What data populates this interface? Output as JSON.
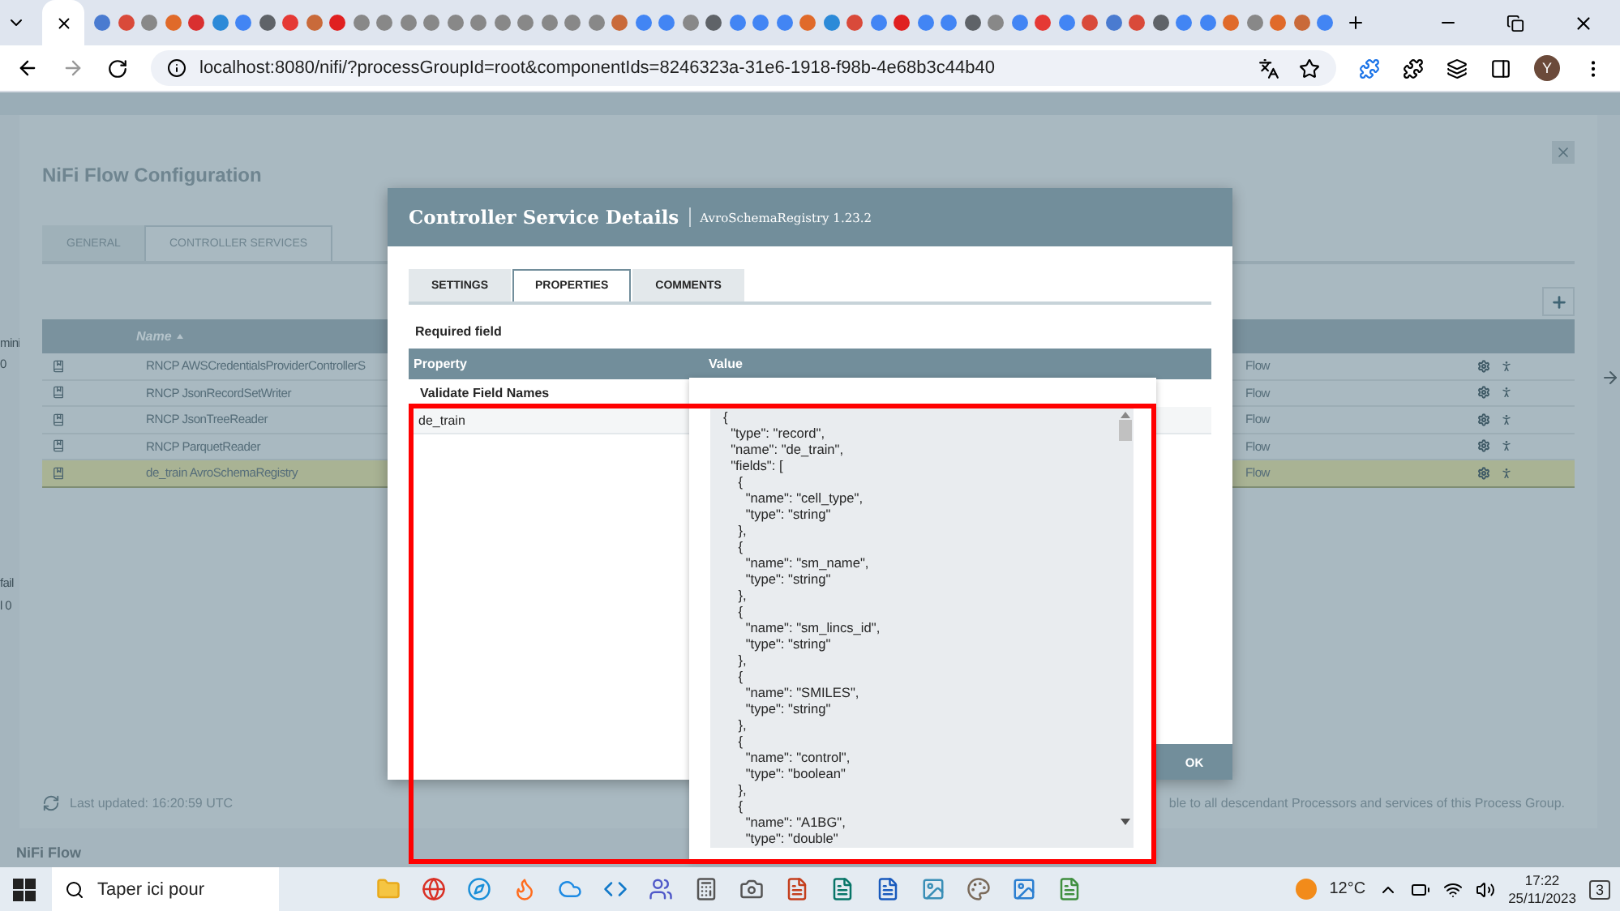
{
  "browser": {
    "url": "localhost:8080/nifi/?processGroupId=root&componentIds=8246323a-31e6-1918-f98b-4e68b3c44b40",
    "profile_initial": "Y"
  },
  "canvas": {
    "left_labels": [
      "mini",
      "0",
      "fail",
      "l 0"
    ],
    "breadcrumb": "NiFi Flow"
  },
  "flow_configuration": {
    "title": "NiFi Flow Configuration",
    "tabs": [
      {
        "label": "GENERAL",
        "selected": false
      },
      {
        "label": "CONTROLLER SERVICES",
        "selected": true
      }
    ],
    "name_column": {
      "label": "Name",
      "sorted": true
    },
    "services": [
      {
        "name": "RNCP AWSCredentialsProviderControllerS",
        "scope": "Flow",
        "selected": false
      },
      {
        "name": "RNCP JsonRecordSetWriter",
        "scope": "Flow",
        "selected": false
      },
      {
        "name": "RNCP JsonTreeReader",
        "scope": "Flow",
        "selected": false
      },
      {
        "name": "RNCP ParquetReader",
        "scope": "Flow",
        "selected": false
      },
      {
        "name": "de_train AvroSchemaRegistry",
        "scope": "Flow",
        "selected": true
      }
    ],
    "last_updated": "Last updated: 16:20:59 UTC",
    "scope_note": "ble to all descendant Processors and services of this Process Group."
  },
  "service_details": {
    "title": "Controller Service Details",
    "subtitle": "AvroSchemaRegistry 1.23.2",
    "tabs": [
      {
        "label": "SETTINGS",
        "selected": false
      },
      {
        "label": "PROPERTIES",
        "selected": true
      },
      {
        "label": "COMMENTS",
        "selected": false
      }
    ],
    "required_label": "Required field",
    "columns": [
      "Property",
      "Value"
    ],
    "properties": [
      {
        "name": "Validate Field Names",
        "kind": "section"
      },
      {
        "name": "de_train",
        "kind": "property"
      }
    ],
    "ok_button": "OK"
  },
  "value_editor": {
    "lines": [
      "{",
      "  \"type\": \"record\",",
      "  \"name\": \"de_train\",",
      "  \"fields\": [",
      "    {",
      "      \"name\": \"cell_type\",",
      "      \"type\": \"string\"",
      "    },",
      "    {",
      "      \"name\": \"sm_name\",",
      "      \"type\": \"string\"",
      "    },",
      "    {",
      "      \"name\": \"sm_lincs_id\",",
      "      \"type\": \"string\"",
      "    },",
      "    {",
      "      \"name\": \"SMILES\",",
      "      \"type\": \"string\"",
      "    },",
      "    {",
      "      \"name\": \"control\",",
      "      \"type\": \"boolean\"",
      "    },",
      "    {",
      "      \"name\": \"A1BG\",",
      "      \"type\": \"double\""
    ]
  },
  "taskbar": {
    "search_placeholder": "Taper ici pour",
    "temperature": "12°C",
    "time": "17:22",
    "date": "25/11/2023",
    "notification_count": "3"
  }
}
